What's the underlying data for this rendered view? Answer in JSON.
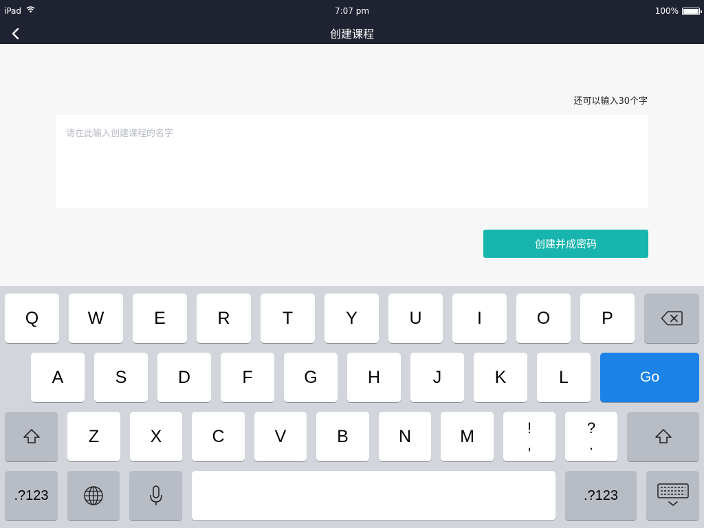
{
  "status_bar": {
    "device": "iPad",
    "time": "7:07 pm",
    "battery": "100%"
  },
  "nav": {
    "title": "创建课程"
  },
  "form": {
    "counter": "还可以输入30个字",
    "placeholder": "请在此输入创建课程的名字",
    "value": "",
    "submit_label": "创建并成密码",
    "accent_color": "#17b5ad"
  },
  "keyboard": {
    "row1": [
      "Q",
      "W",
      "E",
      "R",
      "T",
      "Y",
      "U",
      "I",
      "O",
      "P"
    ],
    "row2": [
      "A",
      "S",
      "D",
      "F",
      "G",
      "H",
      "J",
      "K",
      "L"
    ],
    "go_label": "Go",
    "row3": [
      "Z",
      "X",
      "C",
      "V",
      "B",
      "N",
      "M"
    ],
    "punct1_top": "!",
    "punct1_bottom": ",",
    "punct2_top": "?",
    "punct2_bottom": ".",
    "numbers_label": ".?123",
    "icons": [
      "backspace-icon",
      "shift-icon",
      "globe-icon",
      "microphone-icon",
      "keyboard-dismiss-icon"
    ],
    "go_color": "#1b83e8"
  }
}
